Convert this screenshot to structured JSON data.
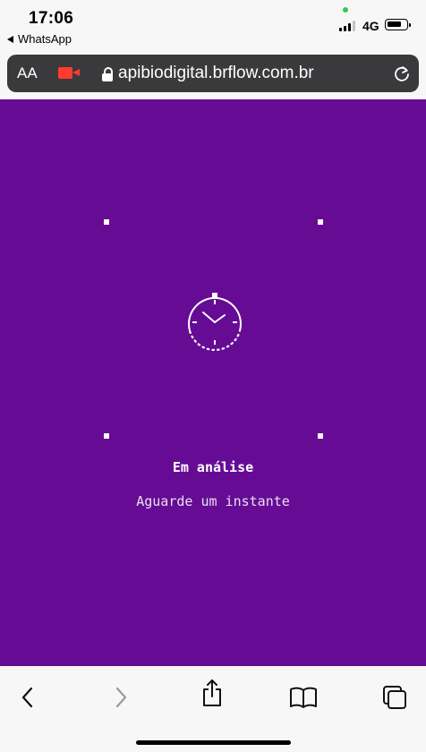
{
  "status_bar": {
    "time": "17:06",
    "back_app": "WhatsApp",
    "network": "4G",
    "icons": [
      "signal-icon",
      "battery-icon"
    ]
  },
  "address_bar": {
    "text_size_label": "AA",
    "url": "apibiodigital.brflow.com.br",
    "icons": [
      "camera-recording-icon",
      "lock-icon",
      "reload-icon"
    ]
  },
  "main": {
    "background": "#660c94",
    "title": "Em análise",
    "subtitle": "Aguarde um instante",
    "icon": "clock-icon"
  },
  "toolbar": {
    "icons": [
      "back-icon",
      "forward-icon",
      "share-icon",
      "bookmarks-icon",
      "tabs-icon"
    ]
  }
}
